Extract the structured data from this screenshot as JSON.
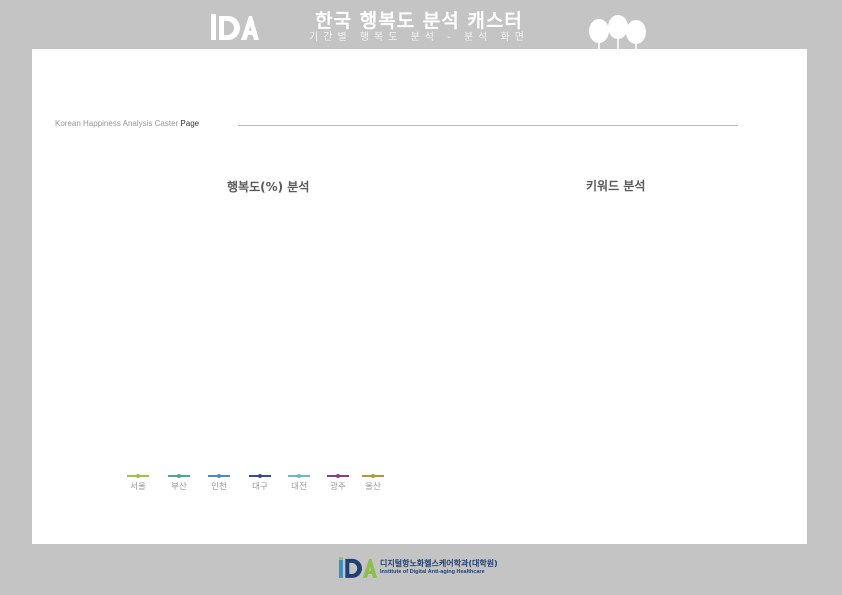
{
  "header": {
    "logo_text": "IDA",
    "title": "한국 행복도 분석 캐스터",
    "subtitle": "기간별 행복도 분석 - 분석 화면",
    "balloons_icon": "balloons-icon"
  },
  "panel": {
    "page_label_prefix": "Korean Happiness Analysis Caster ",
    "page_label_suffix": "Page",
    "happiness_title": "행복도(%) 분석",
    "keyword_title": "키워드 분석"
  },
  "legend": [
    {
      "label": "서울",
      "color": "#9bc24b"
    },
    {
      "label": "부산",
      "color": "#4aa890"
    },
    {
      "label": "인천",
      "color": "#4a8fb8"
    },
    {
      "label": "대구",
      "color": "#3b4a8a"
    },
    {
      "label": "대전",
      "color": "#6fb7c8"
    },
    {
      "label": "광주",
      "color": "#8c3b8c"
    },
    {
      "label": "울산",
      "color": "#b8953a"
    }
  ],
  "footer": {
    "logo_text": "IDA",
    "name_ko": "디지털항노화헬스케어학과(대학원)",
    "name_en": "Institute of Digital Anti-aging Healthcare"
  }
}
